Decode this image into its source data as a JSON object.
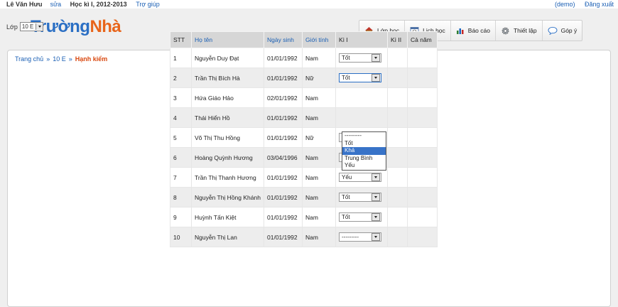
{
  "topbar": {
    "user": "Lê Văn Hưu",
    "edit": "sửa",
    "term": "Học kì I, 2012-2013",
    "help": "Trợ giúp",
    "demo": "(demo)",
    "logout": "Đăng xuất"
  },
  "logo": {
    "part1": "Trường",
    "part2": "Nhà"
  },
  "nav": [
    {
      "label": "Lớp học",
      "icon": "home-icon"
    },
    {
      "label": "Lịch học",
      "icon": "calendar-icon"
    },
    {
      "label": "Báo cáo",
      "icon": "bar-chart-icon"
    },
    {
      "label": "Thiết lập",
      "icon": "gear-icon"
    },
    {
      "label": "Góp ý",
      "icon": "feedback-icon"
    }
  ],
  "breadcrumb": {
    "home": "Trang chủ",
    "sep": "»",
    "class": "10 E",
    "current": "Hạnh kiểm"
  },
  "class_select": {
    "label": "Lớp",
    "value": "10 E"
  },
  "table": {
    "headers": [
      "STT",
      "Họ tên",
      "Ngày sinh",
      "Giới tính",
      "Kì I",
      "Kì II",
      "Cả năm"
    ],
    "rows": [
      {
        "stt": "1",
        "name": "Nguyễn Duy Đạt",
        "dob": "01/01/1992",
        "gender": "Nam",
        "k1": "Tốt"
      },
      {
        "stt": "2",
        "name": "Trần Thị Bích Hà",
        "dob": "01/01/1992",
        "gender": "Nữ",
        "k1": "Tốt"
      },
      {
        "stt": "3",
        "name": "Hứa Giáo Hảo",
        "dob": "02/01/1992",
        "gender": "Nam",
        "k1": ""
      },
      {
        "stt": "4",
        "name": "Thái Hiển Hồ",
        "dob": "01/01/1992",
        "gender": "Nam",
        "k1": ""
      },
      {
        "stt": "5",
        "name": "Võ Thị Thu Hồng",
        "dob": "01/01/1992",
        "gender": "Nữ",
        "k1": "Trung Bình"
      },
      {
        "stt": "6",
        "name": "Hoàng Quỳnh Hương",
        "dob": "03/04/1996",
        "gender": "Nam",
        "k1": "Khá"
      },
      {
        "stt": "7",
        "name": "Trần Thị Thanh Hương",
        "dob": "01/01/1992",
        "gender": "Nam",
        "k1": "Yếu"
      },
      {
        "stt": "8",
        "name": "Nguyễn Thị Hồng Khánh",
        "dob": "01/01/1992",
        "gender": "Nam",
        "k1": "Tốt"
      },
      {
        "stt": "9",
        "name": "Huỳnh Tấn Kiệt",
        "dob": "01/01/1992",
        "gender": "Nam",
        "k1": "Tốt"
      },
      {
        "stt": "10",
        "name": "Nguyễn Thị Lan",
        "dob": "01/01/1992",
        "gender": "Nam",
        "k1": "---------"
      }
    ]
  },
  "dropdown_options": [
    "---------",
    "Tốt",
    "Khá",
    "Trung Bình",
    "Yếu"
  ],
  "dropdown_highlight": "Khá"
}
